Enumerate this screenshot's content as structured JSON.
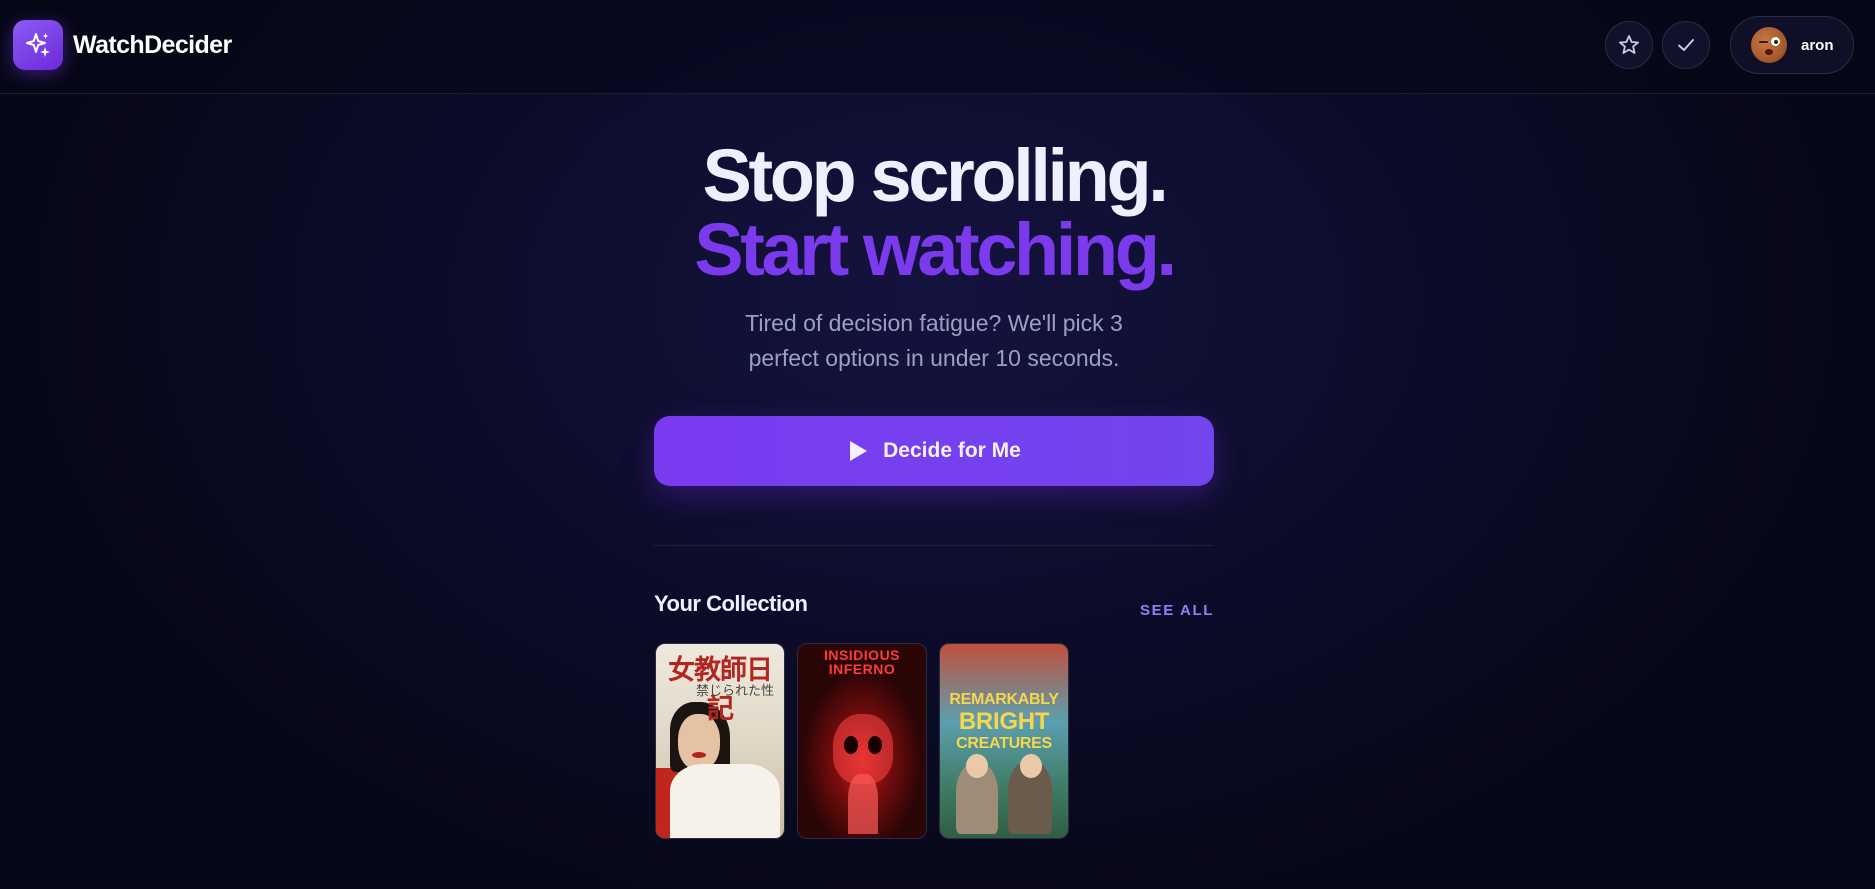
{
  "app": {
    "name": "WatchDecider"
  },
  "header": {
    "favorites_icon": "star-icon",
    "watched_icon": "check-icon",
    "user": {
      "name": "aron"
    }
  },
  "hero": {
    "line1": "Stop scrolling.",
    "line2": "Start watching.",
    "subtitle_line1": "Tired of decision fatigue? We'll pick 3",
    "subtitle_line2": "perfect options in under 10 seconds.",
    "cta_label": "Decide for Me"
  },
  "collection": {
    "title": "Your Collection",
    "see_all": "SEE ALL",
    "posters": [
      {
        "title": "女教師日記",
        "subtitle": "禁じられた性"
      },
      {
        "title_line1": "INSIDIOUS",
        "title_line2": "INFERNO"
      },
      {
        "title_line1": "REMARKABLY",
        "title_line2": "BRIGHT",
        "title_line3": "CREATURES"
      }
    ]
  },
  "colors": {
    "accent": "#7c3aed",
    "background": "#0c0c2a",
    "see_all": "#8b83f5"
  }
}
